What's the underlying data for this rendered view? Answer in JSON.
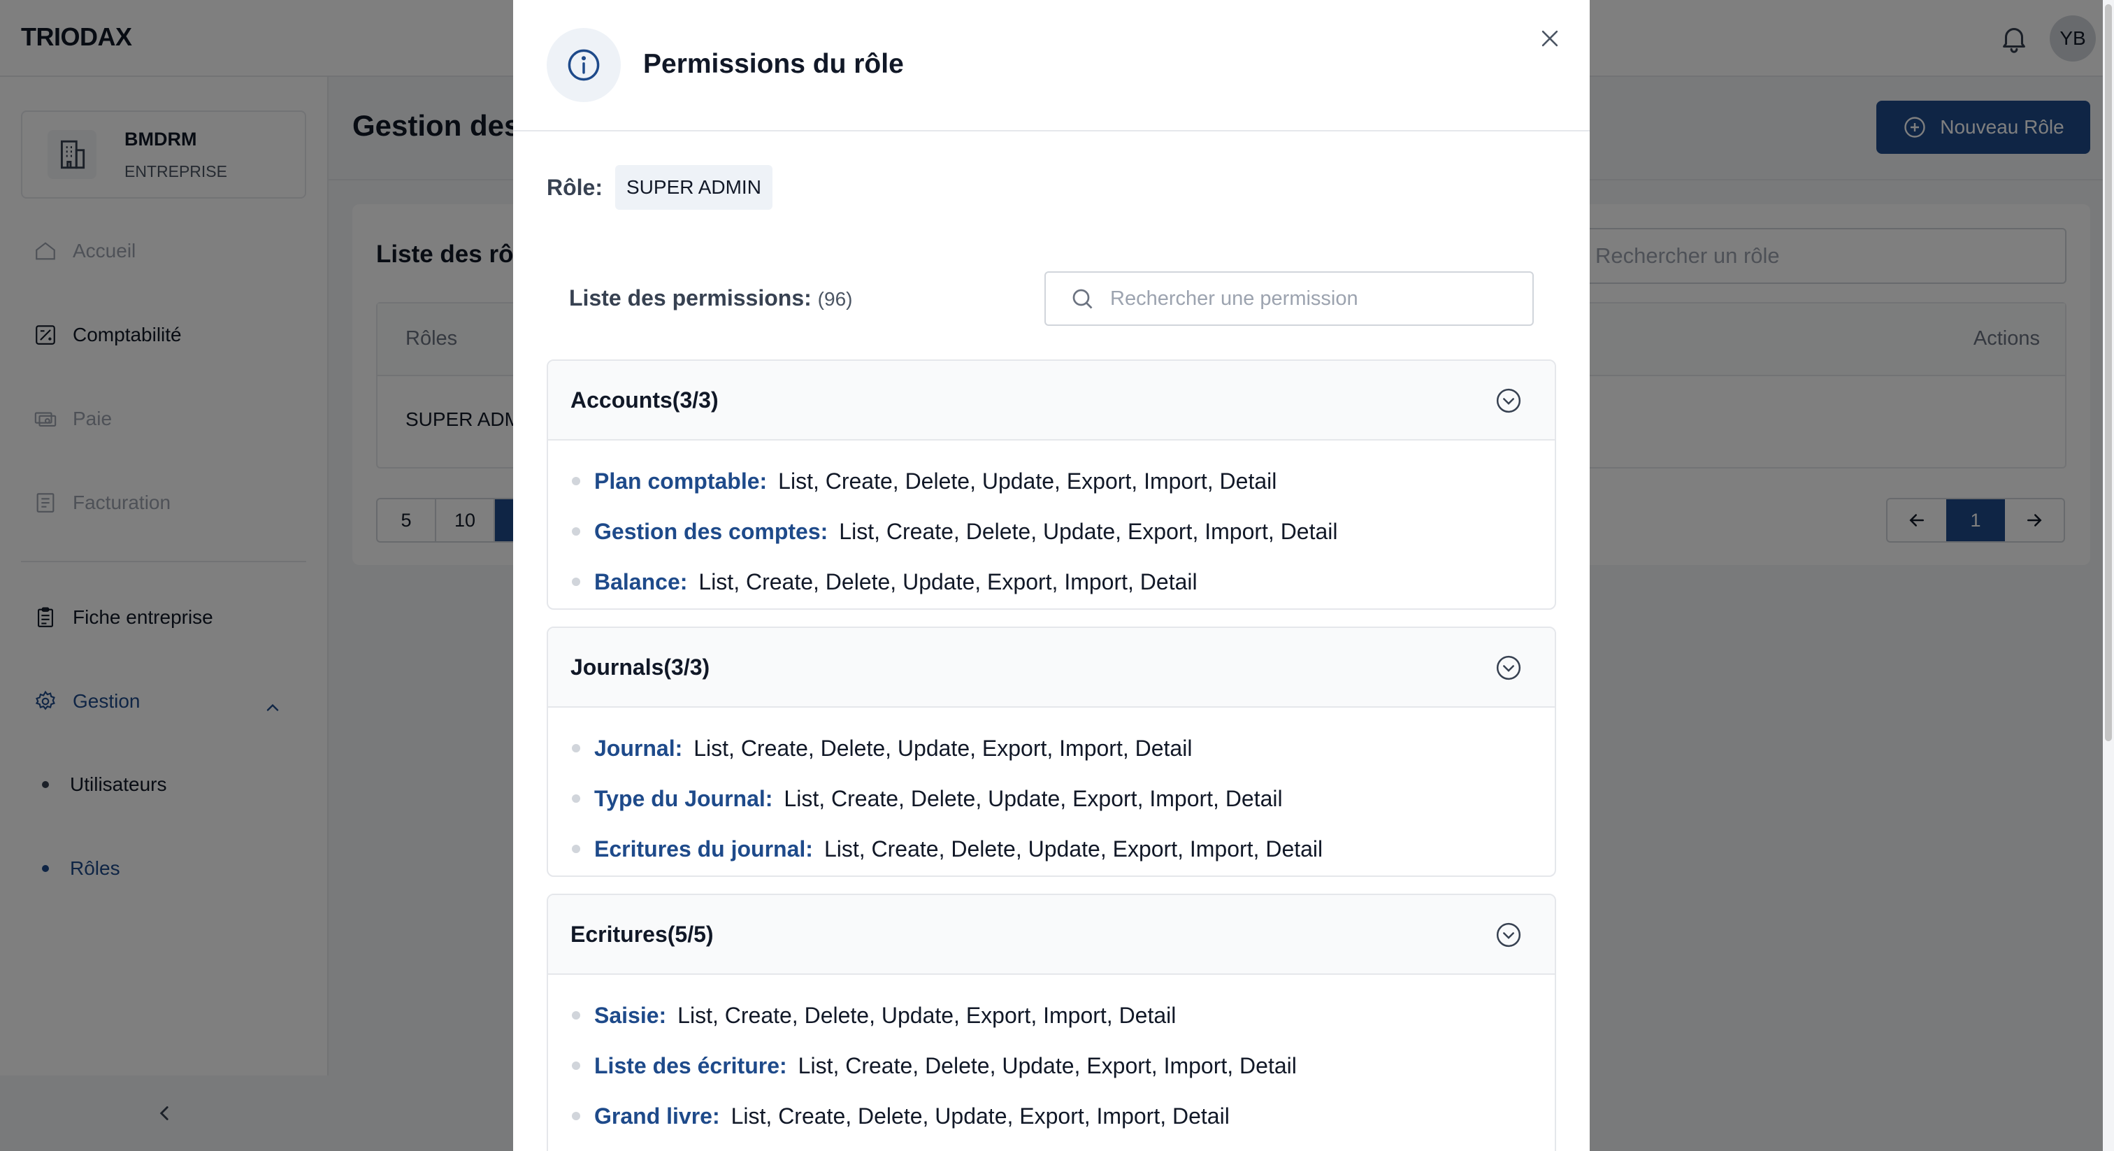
{
  "app": {
    "logo": "TRIODAX",
    "user_initials": "YB"
  },
  "company": {
    "name": "BMDRM",
    "type": "ENTREPRISE"
  },
  "sidebar": {
    "items": [
      {
        "label": "Accueil"
      },
      {
        "label": "Comptabilité"
      },
      {
        "label": "Paie"
      },
      {
        "label": "Facturation"
      },
      {
        "label": "Fiche entreprise"
      },
      {
        "label": "Gestion"
      }
    ],
    "sub_items": [
      {
        "label": "Utilisateurs"
      },
      {
        "label": "Rôles"
      }
    ]
  },
  "page": {
    "title": "Gestion des",
    "new_role_label": "Nouveau Rôle",
    "list_title": "Liste des rô",
    "search_placeholder": "Rechercher un rôle",
    "columns": {
      "roles": "Rôles",
      "actions": "Actions"
    },
    "rows": [
      {
        "role": "SUPER ADM"
      }
    ],
    "page_sizes": [
      "5",
      "10",
      ""
    ],
    "current_page": "1"
  },
  "modal": {
    "title": "Permissions du rôle",
    "role_label": "Rôle:",
    "role_value": "SUPER ADMIN",
    "list_label": "Liste des permissions:",
    "count": "(96)",
    "search_placeholder": "Rechercher une permission",
    "sections": [
      {
        "title": "Accounts(3/3)",
        "perms": [
          {
            "name": "Plan comptable:",
            "actions": "List, Create, Delete, Update, Export, Import, Detail"
          },
          {
            "name": "Gestion des comptes:",
            "actions": "List, Create, Delete, Update, Export, Import, Detail"
          },
          {
            "name": "Balance:",
            "actions": "List, Create, Delete, Update, Export, Import, Detail"
          }
        ]
      },
      {
        "title": "Journals(3/3)",
        "perms": [
          {
            "name": "Journal:",
            "actions": "List, Create, Delete, Update, Export, Import, Detail"
          },
          {
            "name": "Type du Journal:",
            "actions": "List, Create, Delete, Update, Export, Import, Detail"
          },
          {
            "name": "Ecritures du journal:",
            "actions": "List, Create, Delete, Update, Export, Import, Detail"
          }
        ]
      },
      {
        "title": "Ecritures(5/5)",
        "perms": [
          {
            "name": "Saisie:",
            "actions": "List, Create, Delete, Update, Export, Import, Detail"
          },
          {
            "name": "Liste des écriture:",
            "actions": "List, Create, Delete, Update, Export, Import, Detail"
          },
          {
            "name": "Grand livre:",
            "actions": "List, Create, Delete, Update, Export, Import, Detail"
          }
        ]
      }
    ]
  },
  "colors": {
    "accent": "#1e4a8a",
    "overlay": "rgba(0,0,0,0.5)"
  }
}
